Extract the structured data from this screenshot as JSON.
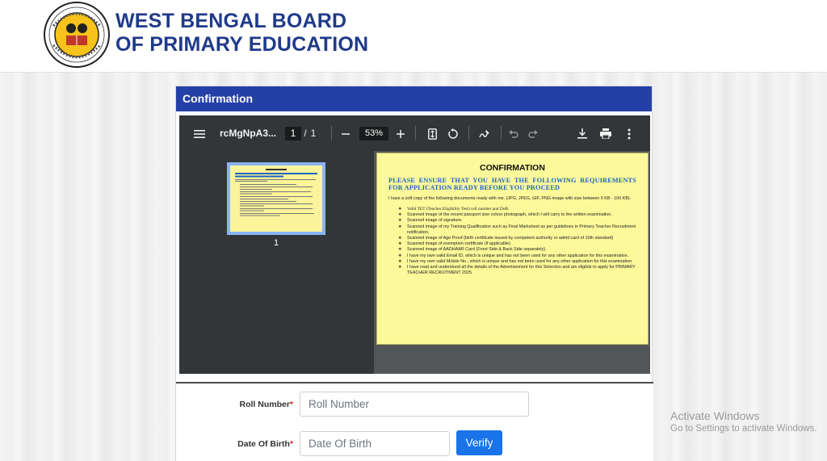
{
  "header": {
    "title_line1": "WEST BENGAL BOARD",
    "title_line2": "OF PRIMARY EDUCATION",
    "logo_icon": "board-seal-logo",
    "brand_color": "#1f3a8a"
  },
  "card": {
    "title": "Confirmation",
    "header_color": "#2440a6"
  },
  "pdf_viewer": {
    "file_name": "rcMgNpA3...",
    "page_current": "1",
    "page_separator": "/",
    "page_total": "1",
    "zoom": "53%",
    "thumbnail_page_number": "1",
    "icons": [
      "menu-icon",
      "zoom-out-icon",
      "zoom-in-icon",
      "fit-page-icon",
      "rotate-icon",
      "annotate-icon",
      "undo-icon",
      "redo-icon",
      "download-icon",
      "print-icon",
      "more-options-icon"
    ]
  },
  "document": {
    "title": "CONFIRMATION",
    "heading": "PLEASE ENSURE THAT YOU HAVE THE FOLLOWING REQUIREMENTS FOR APPLICATION READY BEFORE YOU PROCEED",
    "intro": "I have a soft copy of the following documents ready with me. (JPG, JPEG, GIF, PNG image with size between 5 KB - 100 KB).",
    "items": [
      "Valid TET (Teacher Eligibility Test) roll number and DoB.",
      "Scanned image of the recent passport size colour photograph, which I will carry to the written examination.",
      "Scanned image of signature.",
      "Scanned image of my Training Qualification such as Final Marksheet as per guidelines in Primary Teacher Recruitment notification.",
      "Scanned image of Age Proof (birth certificate issued by competent authority or admit card of 10th standard)",
      "Scanned image of exemption certificate (if applicable)",
      "Scanned image of AADHAAR Card (Front Side & Back Side separately).",
      "I have my own valid Email ID, which is unique and has not been used for any other application for this examination.",
      "I have my own valid Mobile No., which is unique and has not been used for any other application for this examination.",
      "I have read and understood all the details of the Advertisement for this Selection and am eligible to apply for PRIMARY TEACHER RECRUITMENT 2025."
    ]
  },
  "form": {
    "roll_label": "Roll Number",
    "roll_placeholder": "Roll Number",
    "dob_label": "Date Of Birth",
    "dob_placeholder": "Date Of Birth",
    "required_marker": "*",
    "verify_label": "Verify",
    "verify_color": "#1a73e8"
  },
  "watermark": {
    "line1": "Activate Windows",
    "line2": "Go to Settings to activate Windows."
  }
}
